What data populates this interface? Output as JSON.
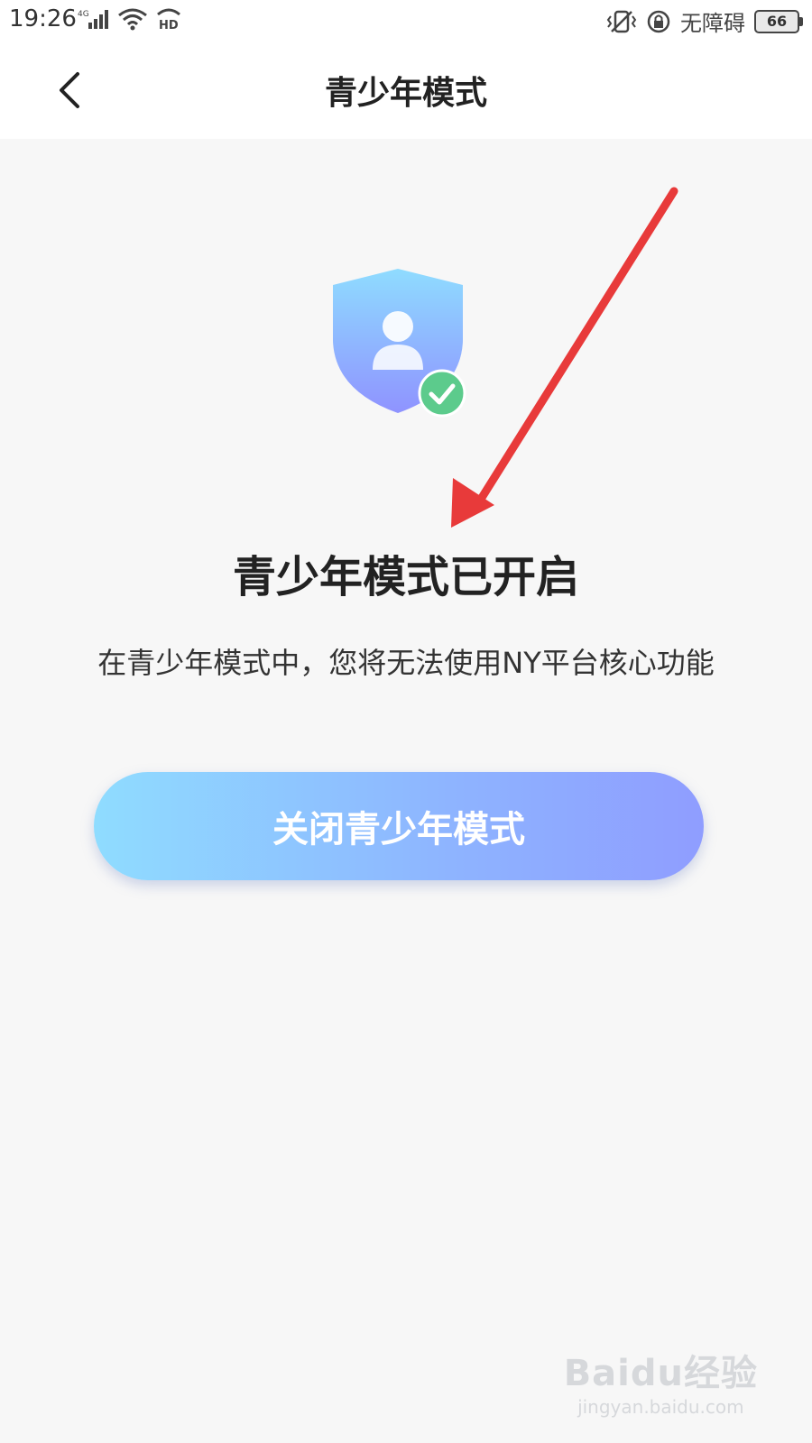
{
  "status_bar": {
    "time": "19:26",
    "network": "4G",
    "hd": "HD",
    "accessibility": "无障碍",
    "battery": "66"
  },
  "header": {
    "title": "青少年模式"
  },
  "main": {
    "status_title": "青少年模式已开启",
    "description": "在青少年模式中，您将无法使用NY平台核心功能",
    "close_button_label": "关闭青少年模式"
  },
  "watermark": {
    "logo": "Baidu经验",
    "url": "jingyan.baidu.com"
  },
  "colors": {
    "button_gradient_start": "#8fdcff",
    "button_gradient_end": "#8f9dff",
    "check_badge": "#5ccb8c",
    "annotation_arrow": "#e83a3a"
  }
}
